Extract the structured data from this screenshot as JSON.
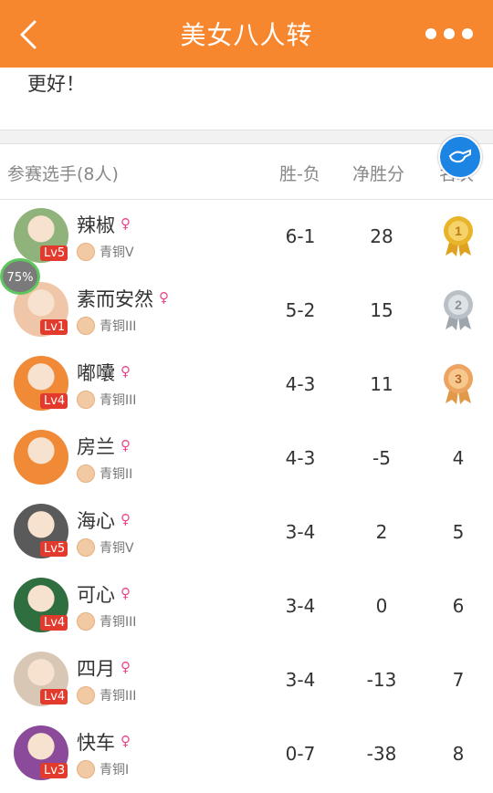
{
  "header": {
    "title": "美女八人转"
  },
  "note": {
    "text": "更好！"
  },
  "table": {
    "columns": {
      "player": "参赛选手(8人)",
      "wl": "胜-负",
      "net": "净胜分",
      "rank": "名次"
    }
  },
  "progress_badge": "75%",
  "players": [
    {
      "name": "辣椒",
      "level": "Lv5",
      "tier": "青铜V",
      "wl": "6-1",
      "net": "28",
      "rank": "1",
      "medal": "gold",
      "avatar_color": "#8fb37a"
    },
    {
      "name": "素而安然",
      "level": "Lv1",
      "tier": "青铜III",
      "wl": "5-2",
      "net": "15",
      "rank": "2",
      "medal": "silver",
      "avatar_color": "#f0c6a8"
    },
    {
      "name": "嘟囔",
      "level": "Lv4",
      "tier": "青铜III",
      "wl": "4-3",
      "net": "11",
      "rank": "3",
      "medal": "bronze",
      "avatar_color": "#f08a36"
    },
    {
      "name": "房兰",
      "level": "",
      "tier": "青铜II",
      "wl": "4-3",
      "net": "-5",
      "rank": "4",
      "medal": "",
      "avatar_color": "#f08a36"
    },
    {
      "name": "海心",
      "level": "Lv5",
      "tier": "青铜V",
      "wl": "3-4",
      "net": "2",
      "rank": "5",
      "medal": "",
      "avatar_color": "#5a5a5a"
    },
    {
      "name": "可心",
      "level": "Lv4",
      "tier": "青铜III",
      "wl": "3-4",
      "net": "0",
      "rank": "6",
      "medal": "",
      "avatar_color": "#2f6e3f"
    },
    {
      "name": "四月",
      "level": "Lv4",
      "tier": "青铜III",
      "wl": "3-4",
      "net": "-13",
      "rank": "7",
      "medal": "",
      "avatar_color": "#d9c7b5"
    },
    {
      "name": "快车",
      "level": "Lv3",
      "tier": "青铜I",
      "wl": "0-7",
      "net": "-38",
      "rank": "8",
      "medal": "",
      "avatar_color": "#8b4a9a"
    }
  ]
}
